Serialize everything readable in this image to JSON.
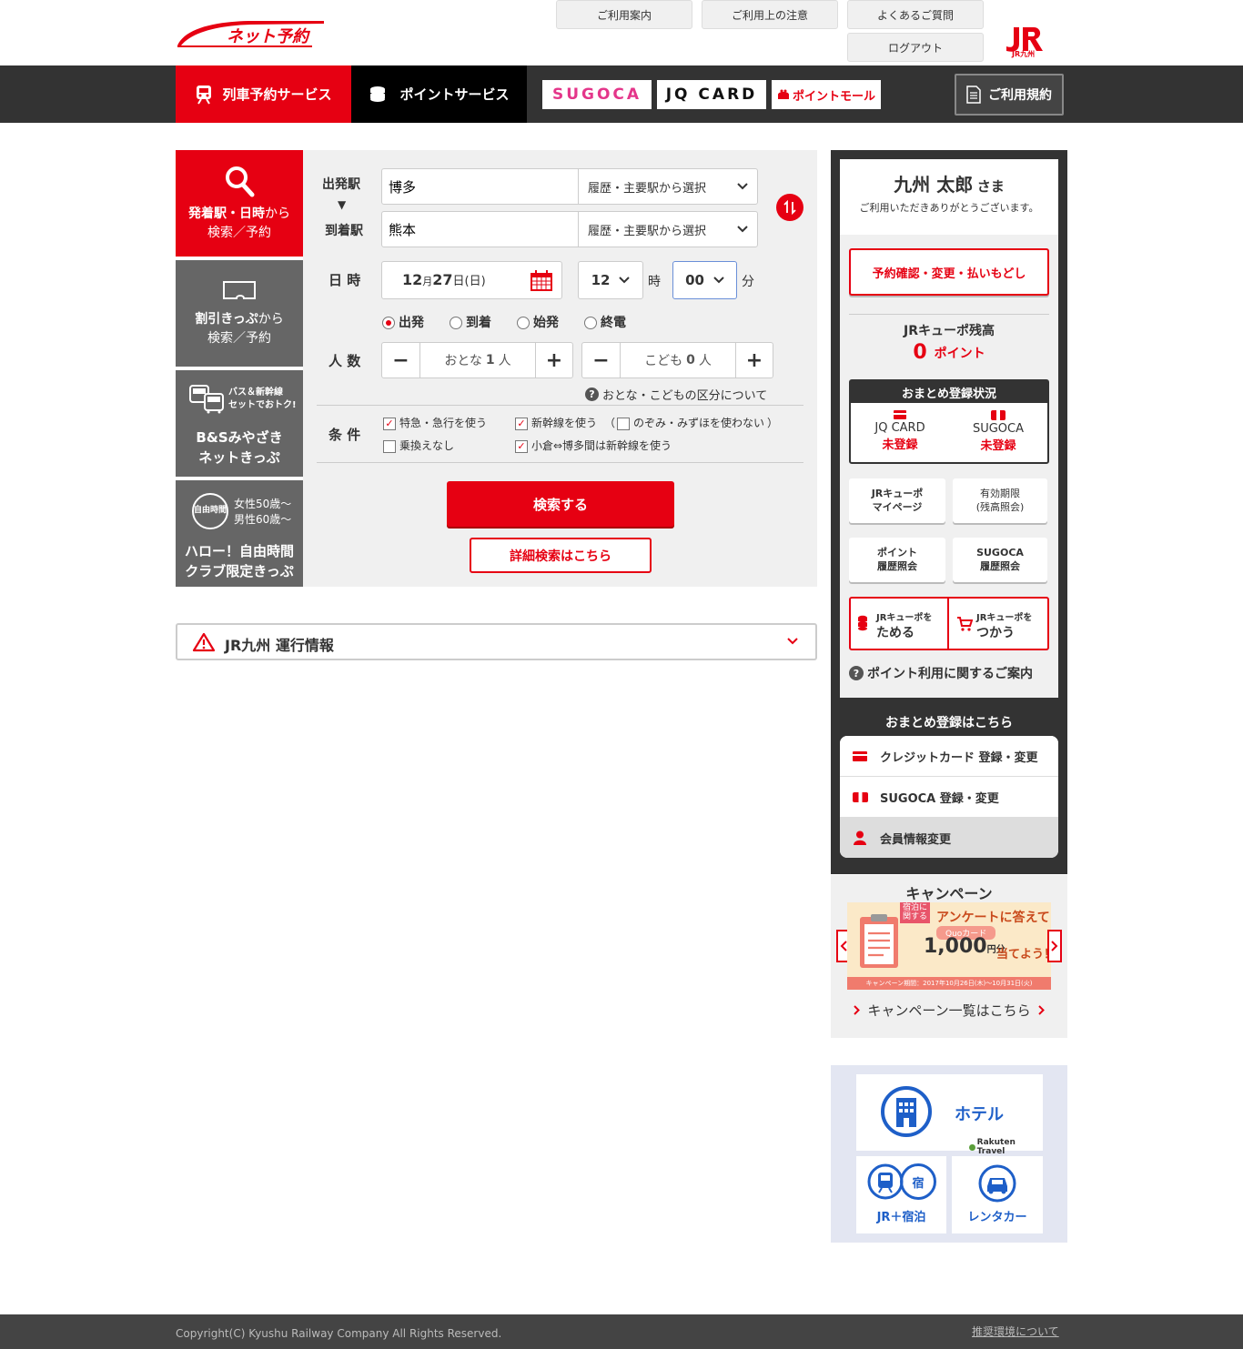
{
  "header": {
    "logo_text": "ネット予約",
    "links": [
      "ご利用案内",
      "ご利用上の注意",
      "よくあるご質問"
    ],
    "logout": "ログアウト",
    "jr_logo": "JR九州"
  },
  "nav": {
    "tab_train": "列車予約サービス",
    "tab_points": "ポイントサービス",
    "brand_sugoca": "SUGOCA",
    "brand_jqcard": "JQ CARD",
    "brand_pointmall": "ポイントモール",
    "terms": "ご利用規約"
  },
  "side_tabs": {
    "search": {
      "line1a": "発着駅・日時",
      "line1b": "から",
      "line2": "検索／予約"
    },
    "discount": {
      "line1a": "割引きっぷ",
      "line1b": "から",
      "line2": "検索／予約"
    },
    "bs": {
      "small1": "バス＆新幹線",
      "small2": "セットでおトク!",
      "line1": "B&Sみやざき",
      "line2": "ネットきっぷ"
    },
    "hello": {
      "small1": "女性50歳～",
      "small2": "男性60歳～",
      "line1": "ハロー！自由時間",
      "line2": "クラブ限定きっぷ",
      "badge": "自由時間"
    }
  },
  "form": {
    "dep_label": "出発駅",
    "arrow": "▼",
    "arr_label": "到着駅",
    "dep_value": "博多",
    "arr_value": "熊本",
    "station_select": "履歴・主要駅から選択",
    "date_label": "日 時",
    "date_month": "12",
    "date_month_unit": "月",
    "date_day": "27",
    "date_day_unit": "日",
    "date_weekday": "(日)",
    "hour": "12",
    "hour_unit": "時",
    "minute": "00",
    "minute_unit": "分",
    "radios": [
      {
        "label": "出発",
        "on": true
      },
      {
        "label": "到着",
        "on": false
      },
      {
        "label": "始発",
        "on": false
      },
      {
        "label": "終電",
        "on": false
      }
    ],
    "people_label": "人 数",
    "adult_label": "おとな",
    "adult_count": "1",
    "adult_unit": "人",
    "child_label": "こども",
    "child_count": "0",
    "child_unit": "人",
    "minus": "−",
    "plus": "+",
    "age_note": "おとな・こどもの区分について",
    "cond_label": "条 件",
    "cond_express": "特急・急行を使う",
    "cond_shinkansen": "新幹線を使う",
    "cond_paren_open": "（",
    "cond_nozomi": "のぞみ・みずほを使わない",
    "cond_paren_close": "）",
    "cond_notransfer": "乗換えなし",
    "cond_kokura": "小倉⇔博多間は新幹線を使う",
    "search_btn": "検索する",
    "detail_btn": "詳細検索はこちら"
  },
  "service_info": {
    "title": "JR九州 運行情報"
  },
  "user": {
    "name": "九州 太郎",
    "honorific": "さま",
    "thanks": "ご利用いただきありがとうございます。",
    "reservation_btn": "予約確認・変更・払いもどし",
    "balance_title": "JRキューポ残高",
    "balance_value": "0",
    "balance_unit": "ポイント",
    "matome_title": "おまとめ登録状況",
    "jq_label": "JQ CARD",
    "jq_status": "未登録",
    "sugoca_label": "SUGOCA",
    "sugoca_status": "未登録",
    "btn_mypage_1": "JRキューポ",
    "btn_mypage_2": "マイページ",
    "btn_expiry_1": "有効期限",
    "btn_expiry_2": "(残高照会)",
    "btn_pointhist_1": "ポイント",
    "btn_pointhist_2": "履歴照会",
    "btn_sugocahist_1": "SUGOCA",
    "btn_sugocahist_2": "履歴照会",
    "save_small": "JRキューポを",
    "save_big": "ためる",
    "use_small": "JRキューポを",
    "use_big": "つかう",
    "point_guide": "ポイント利用に関するご案内"
  },
  "matome_menu": {
    "title": "おまとめ登録はこちら",
    "credit": "クレジットカード 登録・変更",
    "sugoca": "SUGOCA 登録・変更",
    "member": "会員情報変更"
  },
  "campaign": {
    "title": "キャンペーン",
    "banner_tag1": "宿泊に",
    "banner_tag2": "関する",
    "banner_headline": "アンケートに答えて",
    "banner_quo": "Quoカード",
    "banner_amount": "1,000",
    "banner_yen": "円分",
    "banner_win": "当てよう！",
    "banner_period": "キャンペーン期間：2017年10月26日(木)〜10月31日(火)",
    "list_link": "キャンペーン一覧はこちら"
  },
  "travel": {
    "hotel": "ホテル",
    "rakuten": "Rakuten Travel",
    "jr_stay": "JR＋宿泊",
    "rental": "レンタカー",
    "stay_glyph": "宿"
  },
  "footer": {
    "copyright": "Copyright(C) Kyushu Railway Company All Rights Reserved.",
    "env_link": "推奨環境について"
  },
  "colors": {
    "accent": "#e60012",
    "dark": "#333333",
    "panel": "#f0f0f0",
    "travel_bg": "#e3e6f2",
    "travel_blue": "#1e5fc8"
  }
}
